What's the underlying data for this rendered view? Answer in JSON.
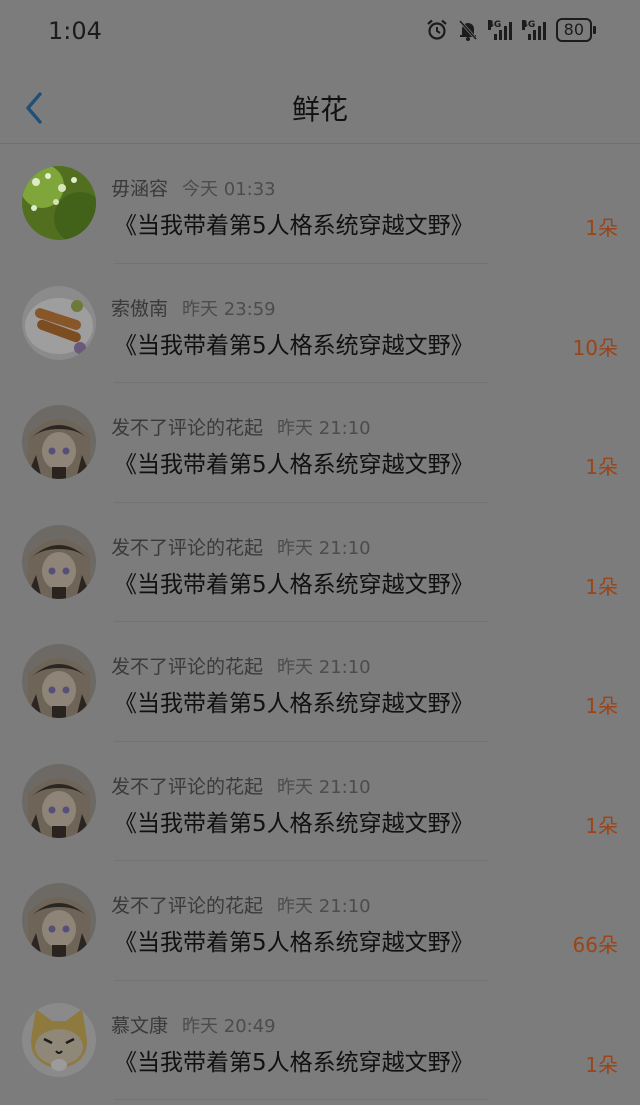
{
  "status_bar": {
    "time": "1:04",
    "battery": "80",
    "network_1": "4G",
    "network_2": "4G"
  },
  "header": {
    "title": "鲜花"
  },
  "items": [
    {
      "user": "毋涵容",
      "time": "今天 01:33",
      "book": "《当我带着第5人格系统穿越文野》",
      "count": "1朵",
      "avatar": "flowers"
    },
    {
      "user": "索傲南",
      "time": "昨天 23:59",
      "book": "《当我带着第5人格系统穿越文野》",
      "count": "10朵",
      "avatar": "food"
    },
    {
      "user": "发不了评论的花起",
      "time": "昨天 21:10",
      "book": "《当我带着第5人格系统穿越文野》",
      "count": "1朵",
      "avatar": "anime"
    },
    {
      "user": "发不了评论的花起",
      "time": "昨天 21:10",
      "book": "《当我带着第5人格系统穿越文野》",
      "count": "1朵",
      "avatar": "anime"
    },
    {
      "user": "发不了评论的花起",
      "time": "昨天 21:10",
      "book": "《当我带着第5人格系统穿越文野》",
      "count": "1朵",
      "avatar": "anime"
    },
    {
      "user": "发不了评论的花起",
      "time": "昨天 21:10",
      "book": "《当我带着第5人格系统穿越文野》",
      "count": "1朵",
      "avatar": "anime"
    },
    {
      "user": "发不了评论的花起",
      "time": "昨天 21:10",
      "book": "《当我带着第5人格系统穿越文野》",
      "count": "66朵",
      "avatar": "anime"
    },
    {
      "user": "慕文康",
      "time": "昨天 20:49",
      "book": "《当我带着第5人格系统穿越文野》",
      "count": "1朵",
      "avatar": "cat"
    }
  ]
}
